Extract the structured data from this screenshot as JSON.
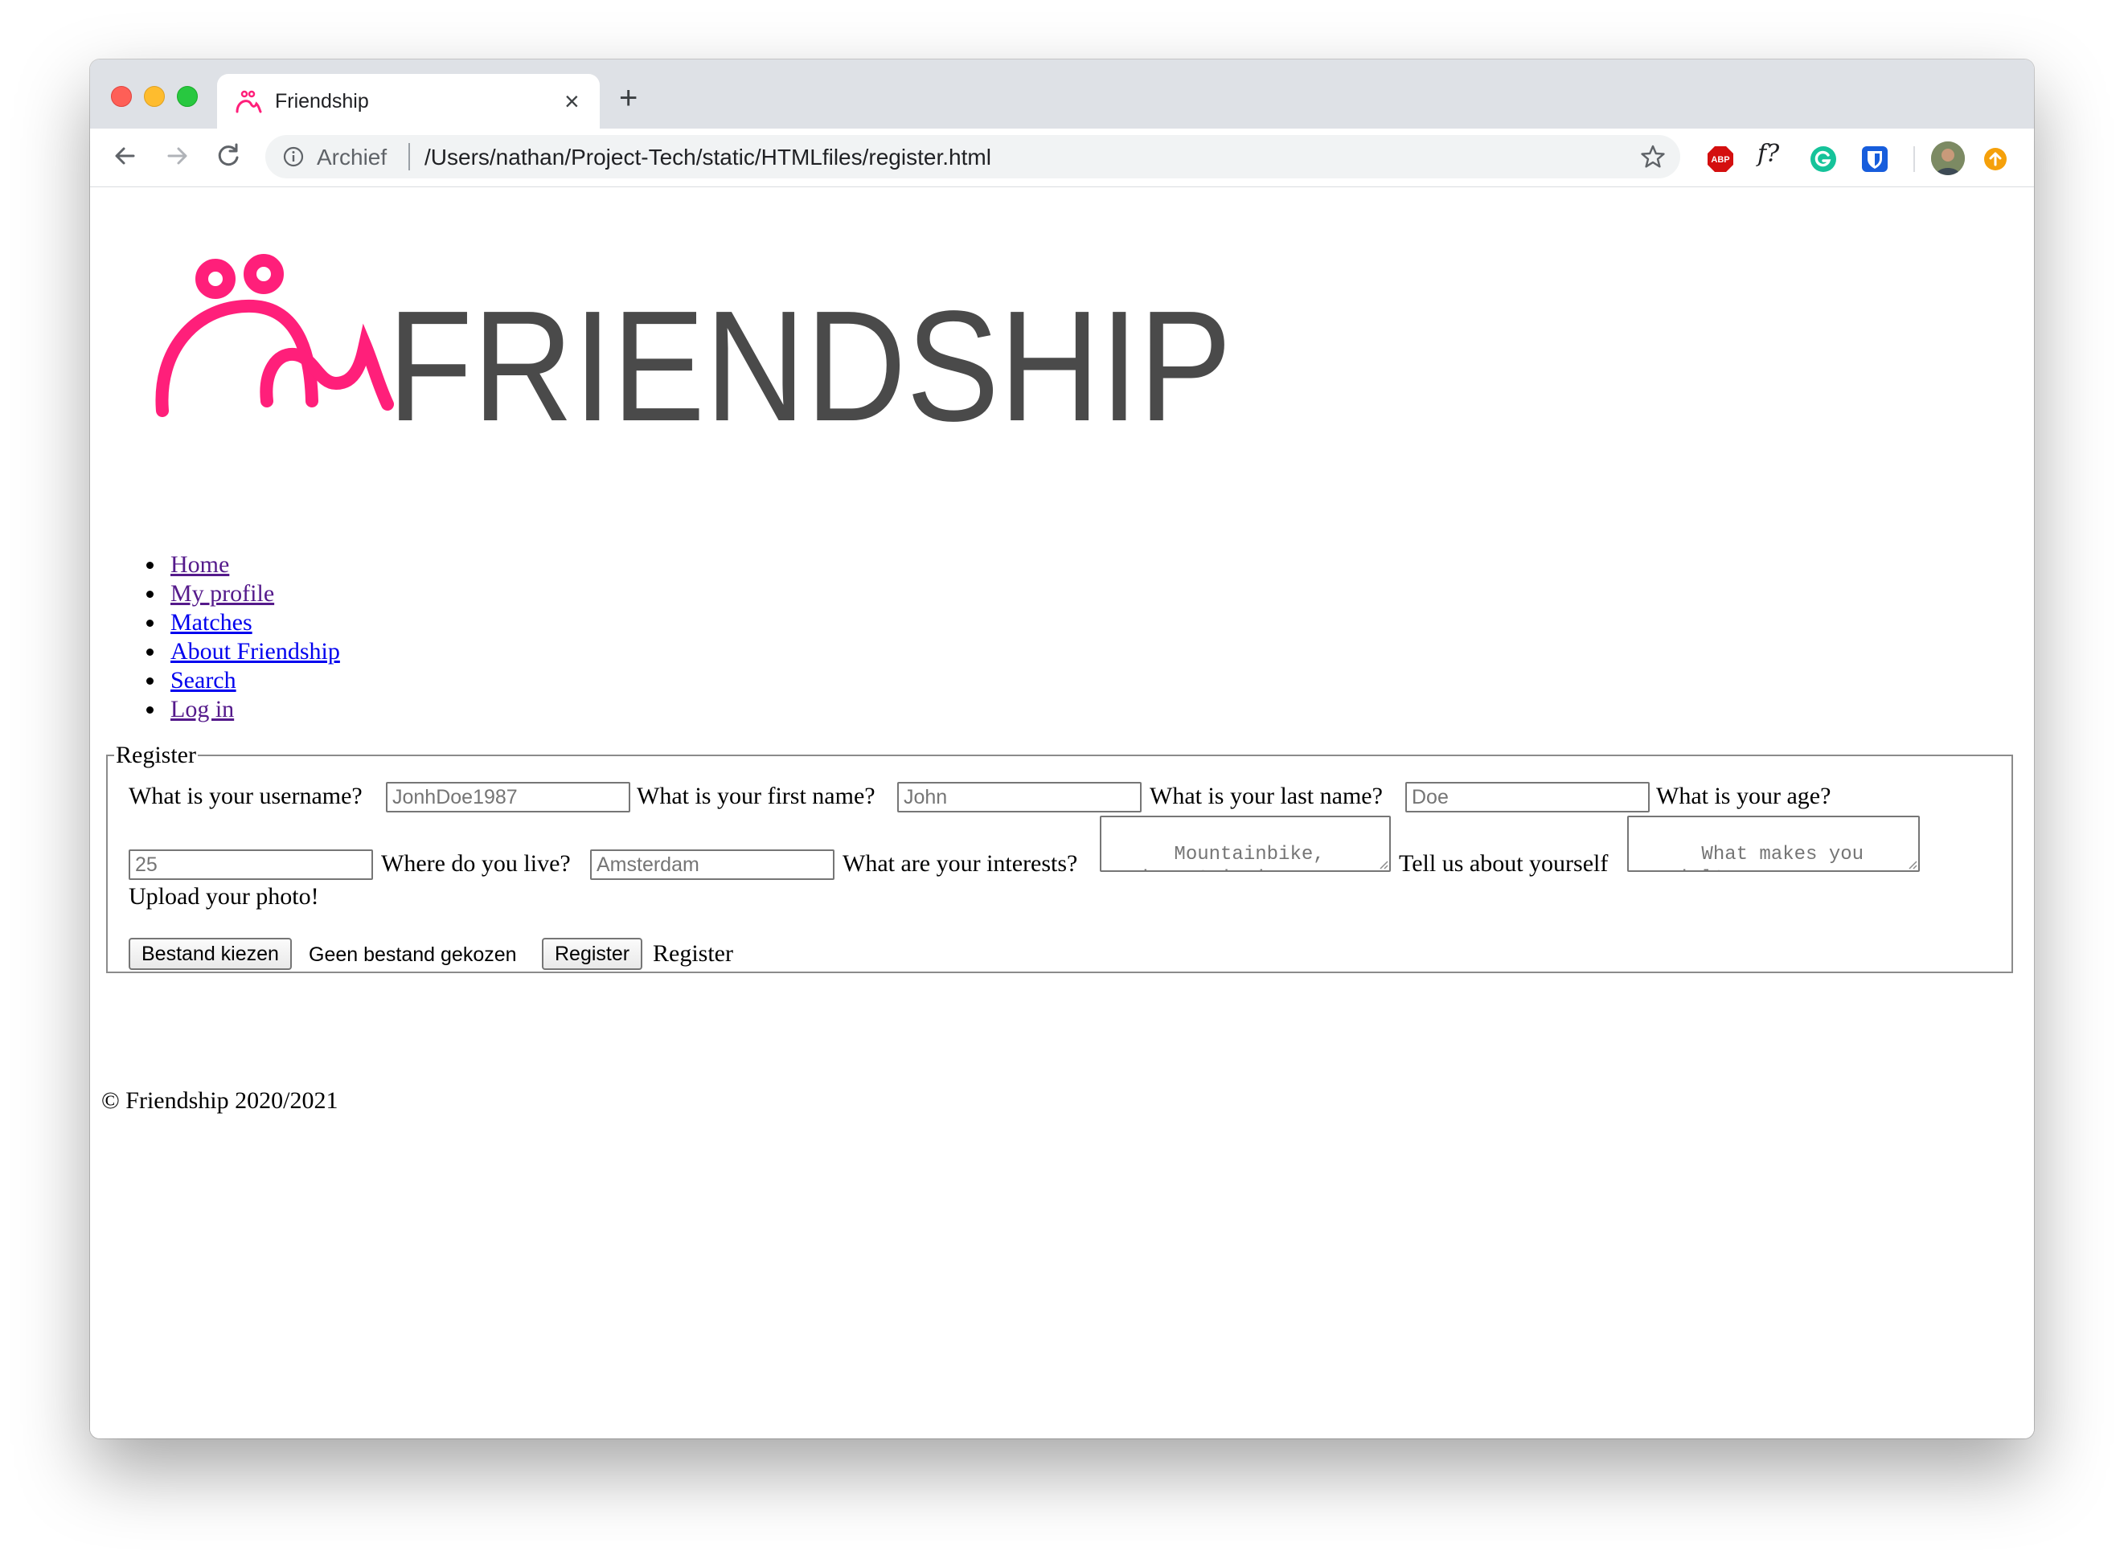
{
  "browser": {
    "tab_title": "Friendship",
    "new_tab_symbol": "+",
    "close_symbol": "×",
    "origin_chip": "Archief",
    "url": "/Users/nathan/Project-Tech/static/HTMLfiles/register.html",
    "extensions": [
      "abp-icon",
      "f-question-icon",
      "grammarly-icon",
      "bitwarden-icon"
    ],
    "ext_f_label": "f?",
    "abp_label": "ABP"
  },
  "logo": {
    "text": "FRIENDSHIP",
    "brand_color": "#ff1f7a",
    "text_color": "#4a4a4a"
  },
  "nav": {
    "items": [
      {
        "label": "Home",
        "visited": true
      },
      {
        "label": "My profile",
        "visited": true
      },
      {
        "label": "Matches",
        "visited": false
      },
      {
        "label": "About Friendship",
        "visited": false
      },
      {
        "label": "Search",
        "visited": false
      },
      {
        "label": "Log in",
        "visited": true
      }
    ]
  },
  "form": {
    "legend": "Register",
    "username_label": "What is your username?",
    "username_placeholder": "JonhDoe1987",
    "firstname_label": "What is your first name?",
    "firstname_placeholder": "John",
    "lastname_label": "What is your last name?",
    "lastname_placeholder": "Doe",
    "age_label": "What is your age?",
    "age_placeholder": "25",
    "location_label": "Where do you live?",
    "location_placeholder": "Amsterdam",
    "interests_label": "What are your interests?",
    "interests_placeholder": "Mountainbike, Movies, Swimming, Gaming,",
    "about_label": "Tell us about yourself",
    "about_placeholder": "What makes you special?",
    "photo_label": "Upload your photo!",
    "choose_file_button": "Bestand kiezen",
    "no_file_text": "Geen bestand gekozen",
    "register_button": "Register",
    "register_text": "Register"
  },
  "footer": {
    "text": "© Friendship 2020/2021"
  }
}
